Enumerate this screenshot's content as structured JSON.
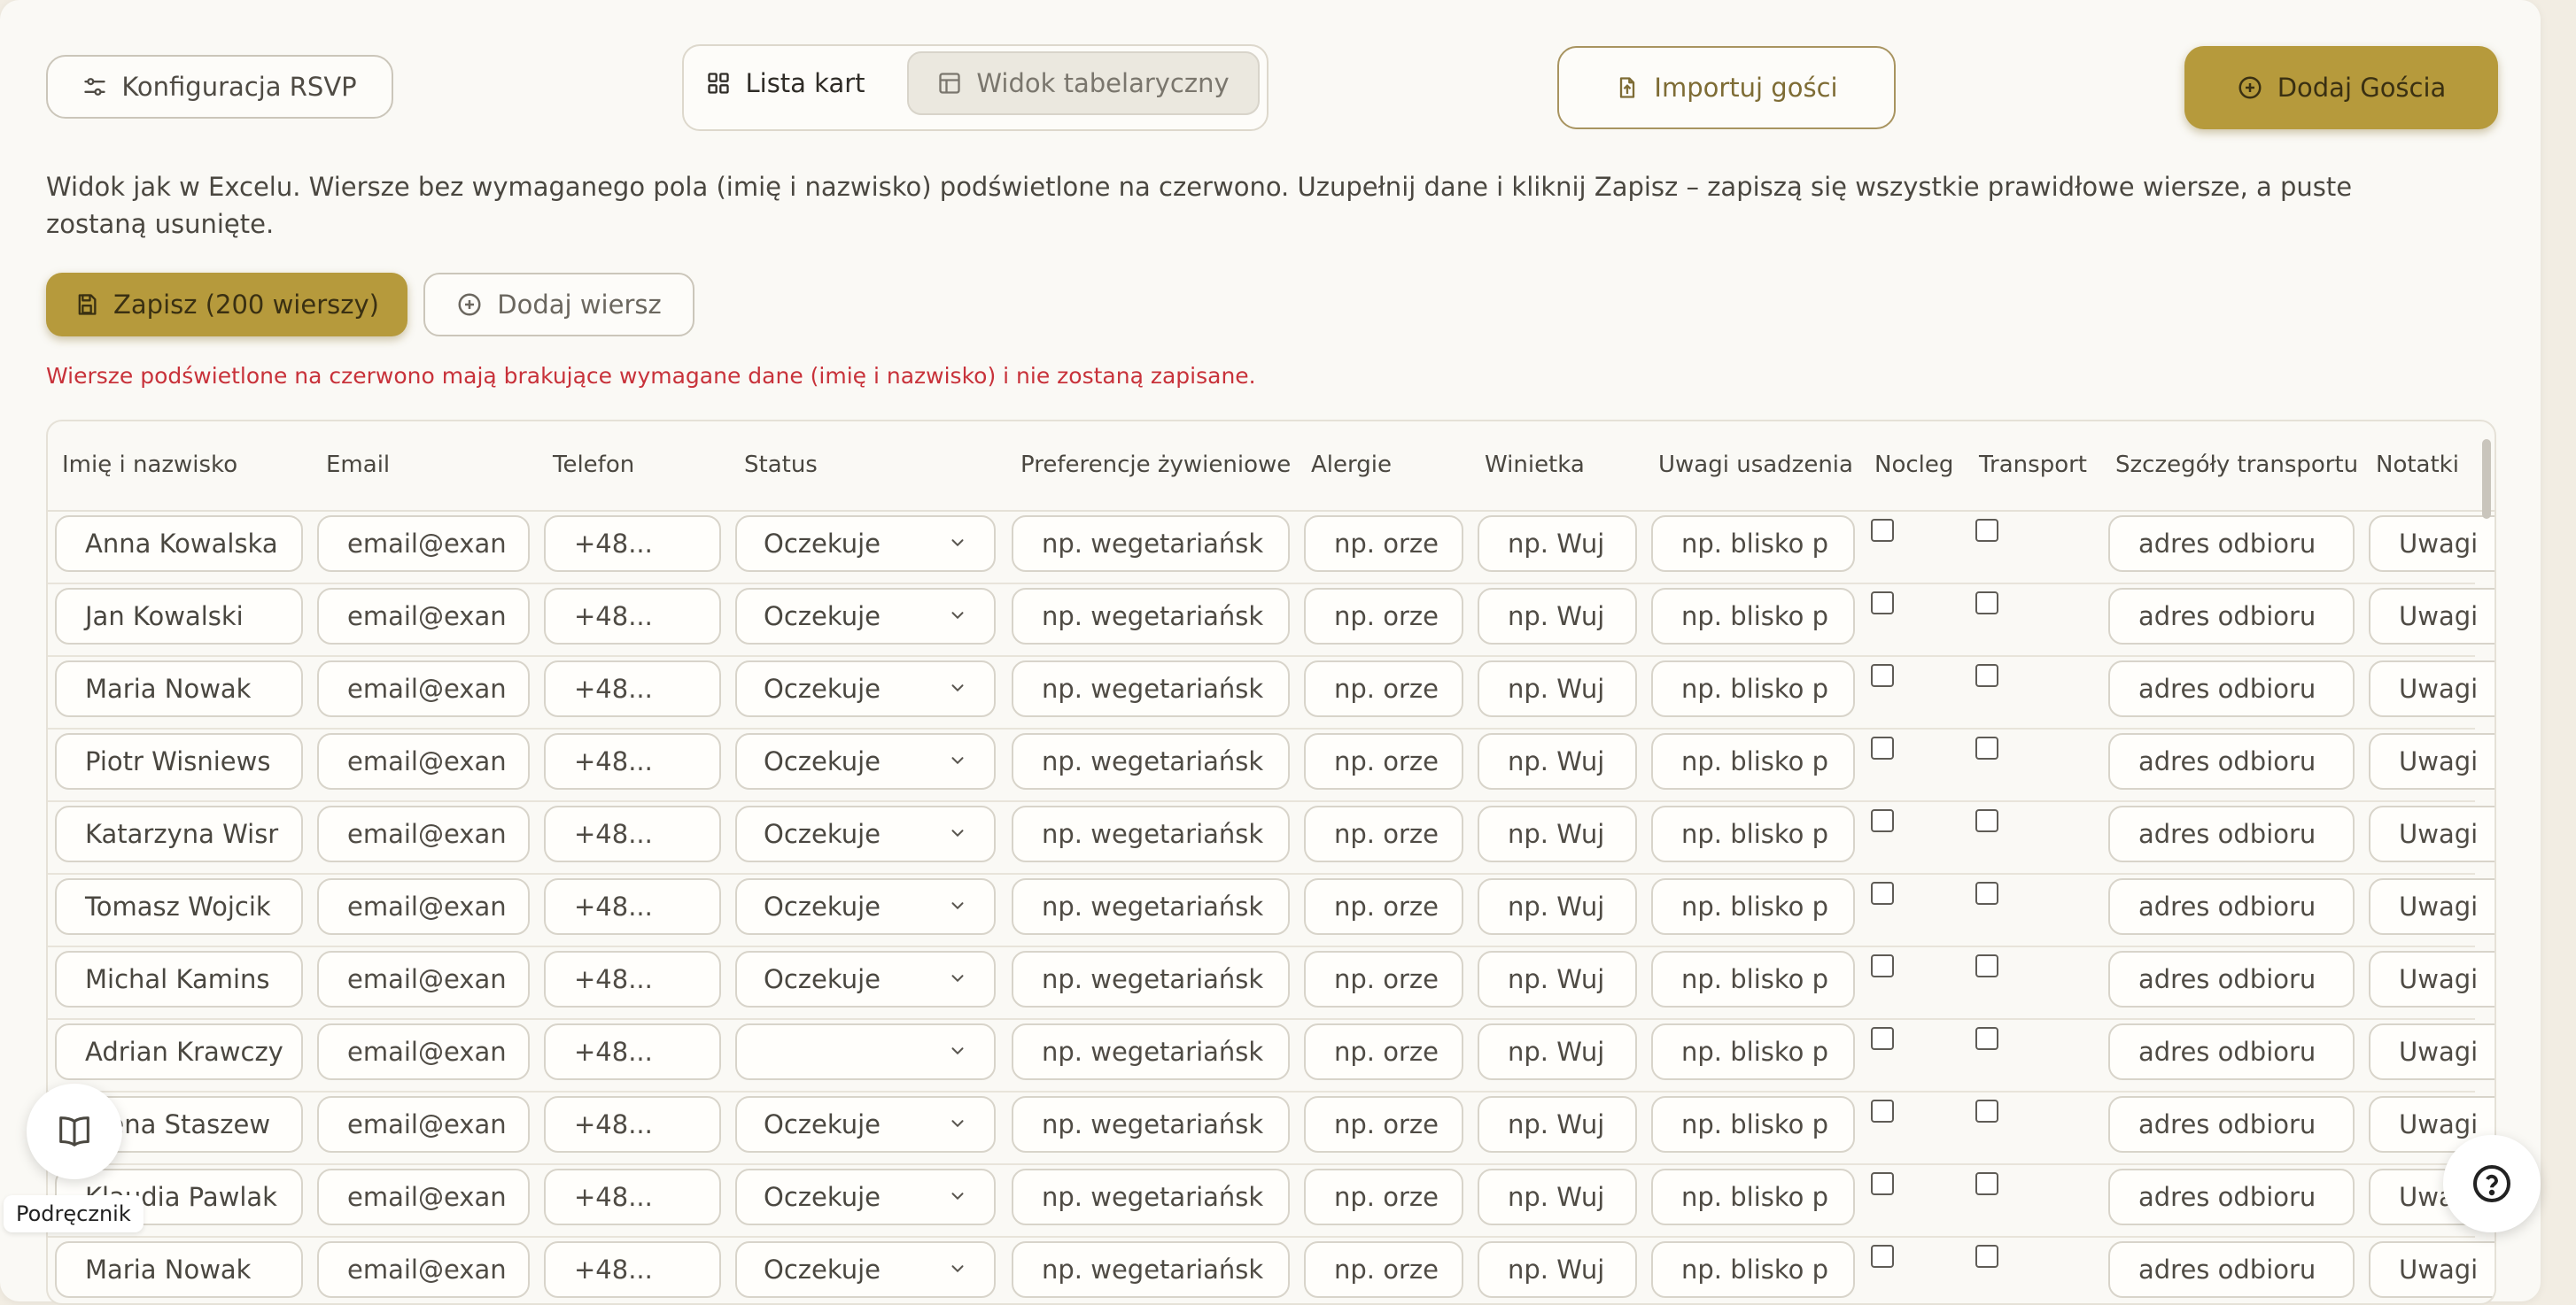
{
  "toolbar": {
    "config_label": "Konfiguracja RSVP",
    "view_cards_label": "Lista kart",
    "view_table_label": "Widok tabelaryczny",
    "import_label": "Importuj gości",
    "add_guest_label": "Dodaj Gościa"
  },
  "description": "Widok jak w Excelu. Wiersze bez wymaganego pola (imię i nazwisko) podświetlone na czerwono. Uzupełnij dane i kliknij Zapisz – zapiszą się wszystkie prawidłowe wiersze, a puste zostaną usunięte.",
  "actions": {
    "save_label": "Zapisz (200 wierszy)",
    "add_row_label": "Dodaj wiersz"
  },
  "warning": "Wiersze podświetlone na czerwono mają brakujące wymagane dane (imię i nazwisko) i nie zostaną zapisane.",
  "table": {
    "columns": [
      "Imię i nazwisko",
      "Email",
      "Telefon",
      "Status",
      "Preferencje żywieniowe",
      "Alergie",
      "Winietka",
      "Uwagi usadzenia",
      "Nocleg",
      "Transport",
      "Szczegóły transportu",
      "Notatki"
    ],
    "placeholders": {
      "email": "email@exan",
      "phone": "+48...",
      "diet": "np. wegetariańsk",
      "allergy": "np. orze",
      "label": "np. Wuj",
      "seating": "np. blisko p",
      "transport_details": "adres odbioru",
      "notes": "Uwagi"
    },
    "rows": [
      {
        "name": "Anna Kowalska",
        "status": "Oczekuje"
      },
      {
        "name": "Jan Kowalski",
        "status": "Oczekuje"
      },
      {
        "name": "Maria Nowak",
        "status": "Oczekuje"
      },
      {
        "name": "Piotr Wisniews",
        "status": "Oczekuje"
      },
      {
        "name": "Katarzyna Wisr",
        "status": "Oczekuje"
      },
      {
        "name": "Tomasz Wojcik",
        "status": "Oczekuje"
      },
      {
        "name": "Michal Kamins",
        "status": "Oczekuje"
      },
      {
        "name": "Adrian Krawczy",
        "status": ""
      },
      {
        "name": "Elena Staszew",
        "status": "Oczekuje"
      },
      {
        "name": "Klaudia Pawlak",
        "status": "Oczekuje"
      },
      {
        "name": "Maria Nowak",
        "status": "Oczekuje"
      }
    ]
  },
  "help": {
    "manual_label": "Podręcznik"
  },
  "colors": {
    "accent_gold": "#b69a3c",
    "warning_red": "#c8323a",
    "background": "#faf9f5"
  },
  "icons": {
    "config": "sliders-icon",
    "cards": "grid-icon",
    "table": "table-icon",
    "import": "file-upload-icon",
    "add": "plus-circle-icon",
    "save": "save-icon",
    "dropdown": "chevron-down-icon",
    "manual": "book-icon",
    "help": "question-circle-icon"
  }
}
